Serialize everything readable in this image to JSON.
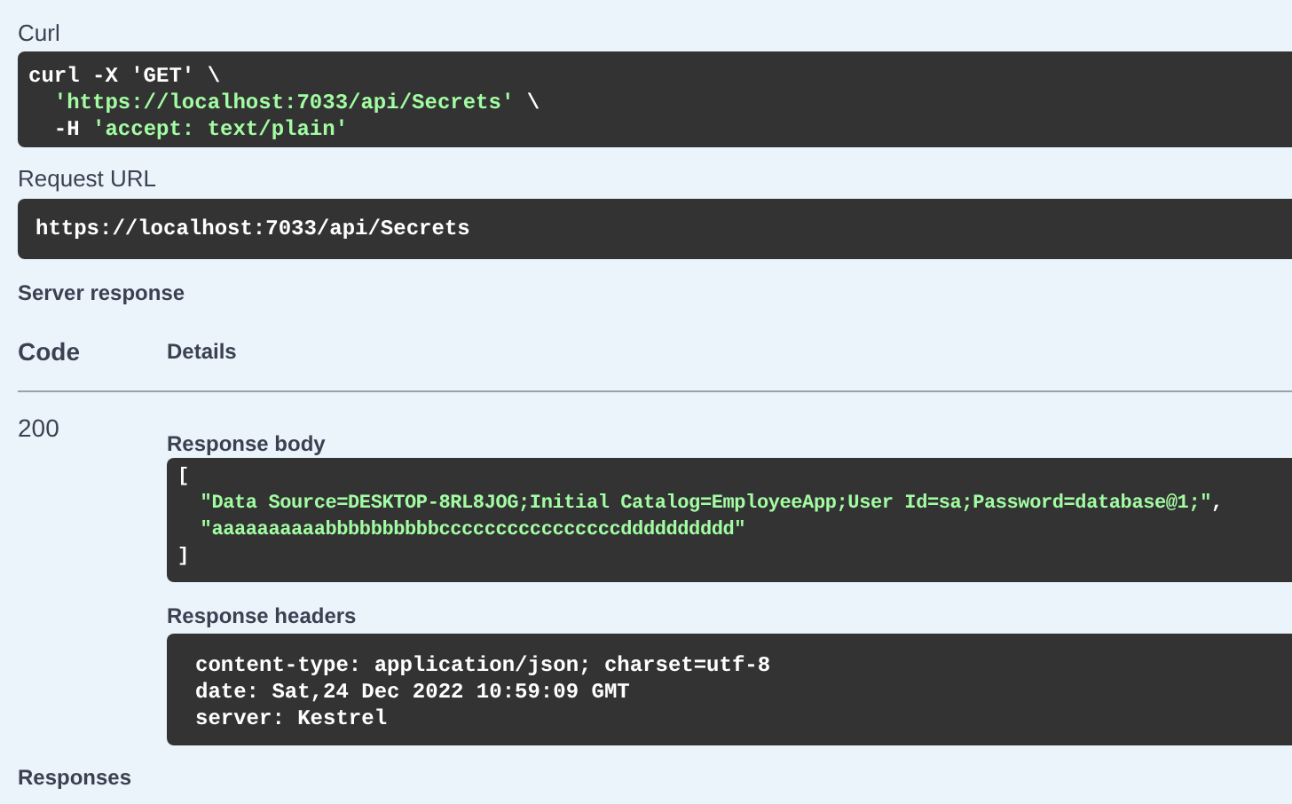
{
  "curl": {
    "label": "Curl",
    "lines": [
      [
        {
          "text": "curl -X ",
          "kind": "plain"
        },
        {
          "text": "'GET'",
          "kind": "plain"
        },
        {
          "text": " \\",
          "kind": "plain"
        }
      ],
      [
        {
          "text": "  'https://localhost:7033/api/Secrets'",
          "kind": "string"
        },
        {
          "text": " \\",
          "kind": "plain"
        }
      ],
      [
        {
          "text": "  -H ",
          "kind": "plain"
        },
        {
          "text": "'accept: text/plain'",
          "kind": "string"
        }
      ]
    ]
  },
  "request_url": {
    "label": "Request URL",
    "value": "https://localhost:7033/api/Secrets"
  },
  "server_response": {
    "title": "Server response",
    "columns": [
      "Code",
      "Details"
    ],
    "code": "200",
    "response_body": {
      "label": "Response body",
      "lines": [
        [
          {
            "text": "[",
            "kind": "plain"
          }
        ],
        [
          {
            "text": "  \"Data Source=DESKTOP-8RL8JOG;Initial Catalog=EmployeeApp;User Id=sa;Password=database@1;\"",
            "kind": "string"
          },
          {
            "text": ",",
            "kind": "plain"
          }
        ],
        [
          {
            "text": "  \"aaaaaaaaaabbbbbbbbbbccccccccccccccccdddddddddd\"",
            "kind": "string"
          }
        ],
        [
          {
            "text": "]",
            "kind": "plain"
          }
        ]
      ]
    },
    "response_headers": {
      "label": "Response headers",
      "lines": [
        "content-type: application/json; charset=utf-8",
        "date: Sat,24 Dec 2022 10:59:09 GMT",
        "server: Kestrel"
      ]
    }
  },
  "responses": {
    "title": "Responses"
  }
}
